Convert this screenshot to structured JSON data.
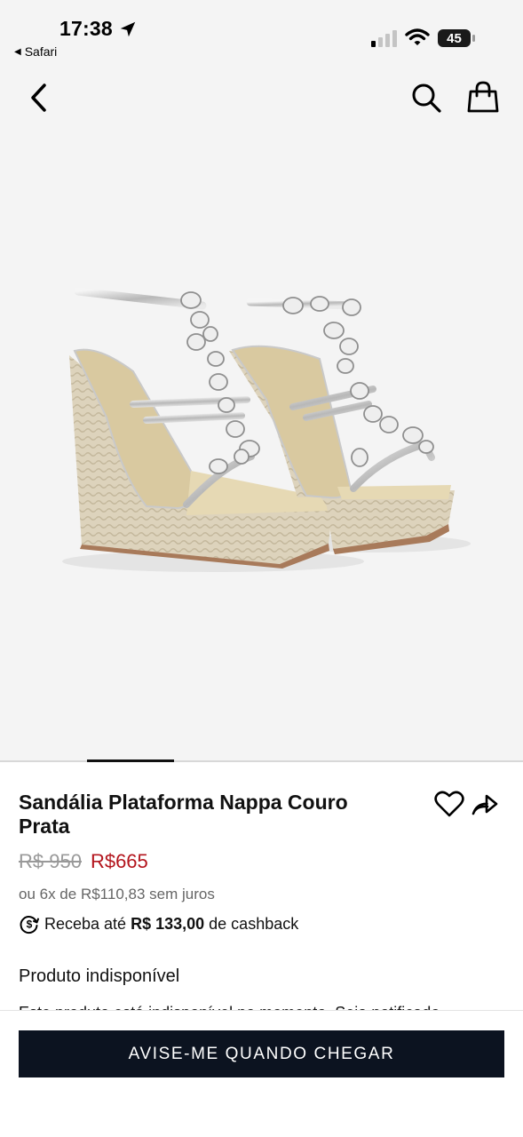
{
  "status_bar": {
    "time": "17:38",
    "back_app": "Safari",
    "battery": "45",
    "icons": [
      "location-arrow-icon",
      "signal-icon",
      "wifi-icon",
      "battery-icon"
    ]
  },
  "nav": {
    "icons": [
      "chevron-left-icon",
      "search-icon",
      "shopping-bag-icon"
    ]
  },
  "gallery": {
    "image": "silver-jeweled-espadrille-wedge-sandals"
  },
  "product": {
    "title": "Sandália Plataforma Nappa Couro Prata",
    "old_price": "R$ 950",
    "price": "R$665",
    "installments": "ou 6x de R$110,83 sem juros",
    "cashback_prefix": "Receba até",
    "cashback_amount": "R$ 133,00",
    "cashback_suffix": "de cashback",
    "unavailable_heading": "Produto indisponível",
    "unavailable_text": "Este produto está indisponível no momento. Seja notificado",
    "price_color": "#b3141c",
    "action_icons": [
      "heart-icon",
      "share-icon"
    ]
  },
  "cta": {
    "label": "AVISE-ME QUANDO CHEGAR",
    "color": "#0c1320"
  }
}
